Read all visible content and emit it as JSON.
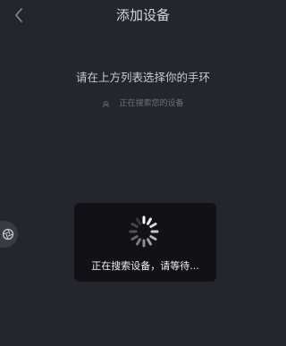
{
  "header": {
    "title": "添加设备",
    "back_icon": "chevron-left-icon"
  },
  "main": {
    "prompt": "请在上方列表选择你的手环",
    "status": {
      "icon": "bluetooth-search-icon",
      "text": "正在搜索您的设备"
    }
  },
  "side_handle": {
    "icon": "aperture-icon"
  },
  "dialog": {
    "spinner_icon": "loading-spinner-icon",
    "text": "正在搜索设备，请等待..."
  },
  "colors": {
    "background": "#25252e",
    "dialog_background": "#111116",
    "title": "#d6d6dc",
    "muted_text": "#6f6f78"
  }
}
